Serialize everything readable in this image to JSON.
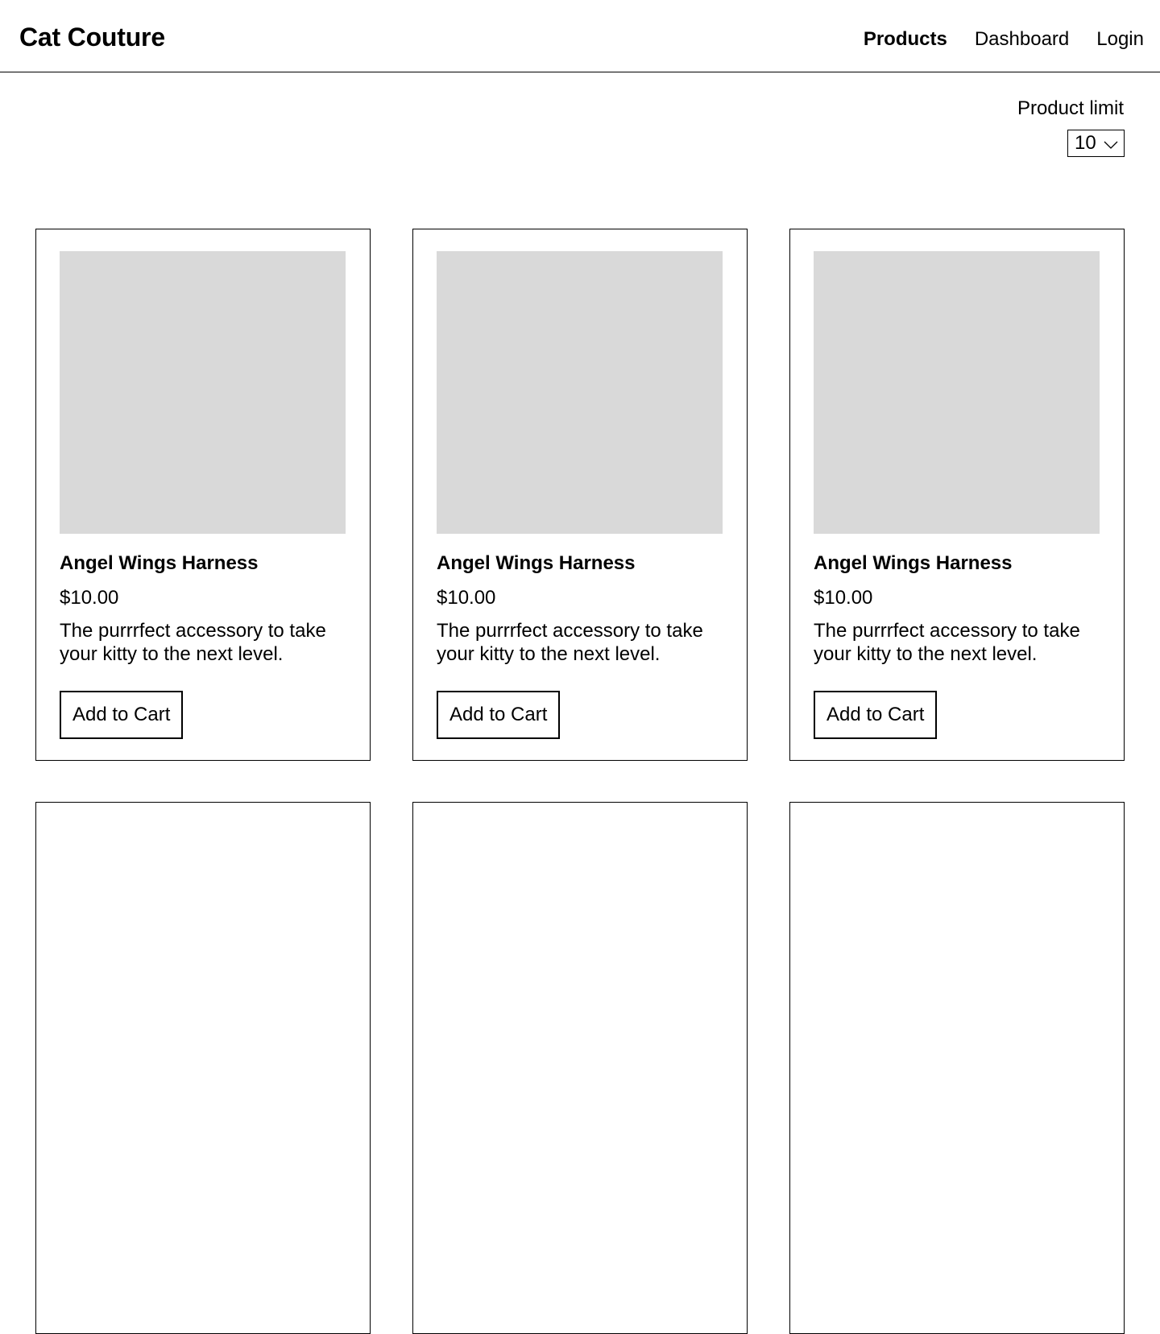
{
  "header": {
    "brand": "Cat Couture",
    "nav": [
      {
        "label": "Products",
        "active": true
      },
      {
        "label": "Dashboard",
        "active": false
      },
      {
        "label": "Login",
        "active": false
      }
    ]
  },
  "filter": {
    "label": "Product limit",
    "selected": "10"
  },
  "products": [
    {
      "name": "Angel Wings Harness",
      "price": "$10.00",
      "description": "The purrrfect accessory to take your kitty to the next level.",
      "button": "Add to Cart"
    },
    {
      "name": "Angel Wings Harness",
      "price": "$10.00",
      "description": "The purrrfect accessory to take your kitty to the next level.",
      "button": "Add to Cart"
    },
    {
      "name": "Angel Wings Harness",
      "price": "$10.00",
      "description": "The purrrfect accessory to take your kitty to the next level.",
      "button": "Add to Cart"
    },
    {
      "name": "",
      "price": "",
      "description": "",
      "button": ""
    },
    {
      "name": "",
      "price": "",
      "description": "",
      "button": ""
    },
    {
      "name": "",
      "price": "",
      "description": "",
      "button": ""
    }
  ],
  "colors": {
    "image_placeholder": "#d9d9d9",
    "border": "#000000"
  },
  "icons": {
    "select_arrow": "chevron-down-icon"
  }
}
